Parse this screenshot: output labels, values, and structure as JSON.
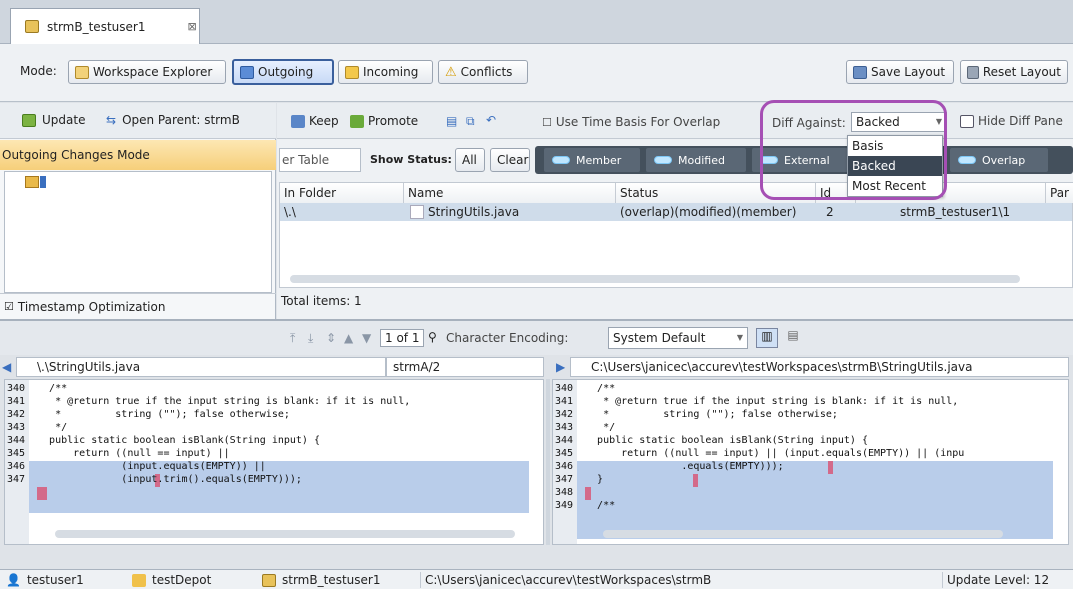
{
  "tab": {
    "title": "strmB_testuser1"
  },
  "modebar": {
    "mode_label": "Mode:",
    "buttons": [
      "Workspace Explorer",
      "Outgoing",
      "Incoming",
      "Conflicts"
    ],
    "save_layout": "Save Layout",
    "reset_layout": "Reset Layout"
  },
  "left": {
    "update": "Update",
    "open_parent": "Open Parent: strmB",
    "panel_title": "Outgoing Changes Mode",
    "timestamp": "Timestamp Optimization"
  },
  "toolbar": {
    "keep": "Keep",
    "promote": "Promote",
    "time_basis": "Use Time Basis For Overlap",
    "diff_against_label": "Diff Against:",
    "diff_against_value": "Backed",
    "hide_diff": "Hide Diff Pane"
  },
  "filter": {
    "filter_text": "er Table",
    "show_status": "Show Status:",
    "all": "All",
    "clear": "Clear",
    "chips": [
      "Member",
      "Modified",
      "External",
      "Overlap"
    ]
  },
  "dropdown": {
    "options": [
      "Basis",
      "Backed",
      "Most Recent"
    ],
    "selected": "Backed"
  },
  "table": {
    "headers": [
      "In Folder",
      "Name",
      "Status",
      "Id",
      "Par"
    ],
    "rows": [
      {
        "folder": "\\.\\",
        "name": "StringUtils.java",
        "status": "(overlap)(modified)(member)",
        "id": "2",
        "stream": "strmB_testuser1\\1"
      }
    ],
    "total": "Total items: 1"
  },
  "diffbar": {
    "page": "1 of 1",
    "encoding_label": "Character Encoding:",
    "encoding_value": "System Default"
  },
  "left_pane": {
    "path": "\\.\\StringUtils.java",
    "version": "strmA/2",
    "line_numbers": [
      "340",
      "341",
      "342",
      "343",
      "344",
      "345",
      "346",
      "347"
    ],
    "lines": [
      "   /**",
      "    * @return true if the input string is blank: if it is null,",
      "    *         string (\"\"); false otherwise;",
      "    */",
      "   public static boolean isBlank(String input) {",
      "       return ((null == input) ||",
      "               (input.equals(EMPTY)) ||",
      "               (input.trim().equals(EMPTY)));"
    ]
  },
  "right_pane": {
    "path": "C:\\Users\\janicec\\accurev\\testWorkspaces\\strmB\\StringUtils.java",
    "line_numbers": [
      "340",
      "341",
      "342",
      "343",
      "344",
      "345",
      "346",
      "347",
      "348",
      "349"
    ],
    "lines": [
      "   /**",
      "    * @return true if the input string is blank: if it is null,",
      "    *         string (\"\"); false otherwise;",
      "    */",
      "   public static boolean isBlank(String input) {",
      "       return ((null == input) || (input.equals(EMPTY)) || (inpu",
      "                 .equals(EMPTY)));",
      "   }",
      "",
      "   /**"
    ]
  },
  "statusbar": {
    "user": "testuser1",
    "depot": "testDepot",
    "workspace": "strmB_testuser1",
    "path": "C:\\Users\\janicec\\accurev\\testWorkspaces\\strmB",
    "update_level": "Update Level: 12"
  }
}
